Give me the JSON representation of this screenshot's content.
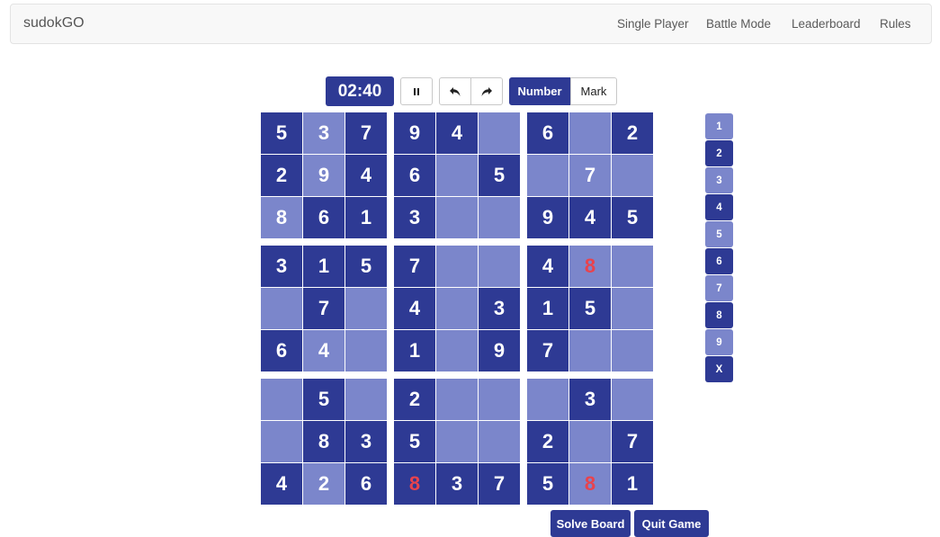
{
  "nav": {
    "brand": "sudokGO",
    "links": [
      "Single Player",
      "Battle Mode",
      "Leaderboard",
      "Rules"
    ]
  },
  "controls": {
    "timer": "02:40",
    "pause_icon": "pause-icon",
    "undo_icon": "undo-arrow-icon",
    "redo_icon": "redo-arrow-icon",
    "mode_number": "Number",
    "mode_mark": "Mark",
    "active_mode": "Number"
  },
  "colors": {
    "given": "#2e3a94",
    "open": "#7b86cb",
    "error_text": "#e8434d"
  },
  "board": [
    [
      "5g",
      "3o",
      "7g",
      "9g",
      "4g",
      "o",
      "6g",
      "o",
      "2g"
    ],
    [
      "2g",
      "9o",
      "4g",
      "6g",
      "o",
      "5g",
      "o",
      "7o",
      "o"
    ],
    [
      "8o",
      "6g",
      "1g",
      "3g",
      "o",
      "o",
      "9g",
      "4g",
      "5g"
    ],
    [
      "3g",
      "1g",
      "5g",
      "7g",
      "o",
      "o",
      "4g",
      "8oe",
      "o"
    ],
    [
      "o",
      "7g",
      "o",
      "4g",
      "o",
      "3g",
      "1g",
      "5g",
      "o"
    ],
    [
      "6g",
      "4o",
      "o",
      "1g",
      "o",
      "9g",
      "7g",
      "o",
      "o"
    ],
    [
      "o",
      "5g",
      "o",
      "2g",
      "o",
      "o",
      "o",
      "3g",
      "o"
    ],
    [
      "o",
      "8g",
      "3g",
      "5g",
      "o",
      "o",
      "2g",
      "o",
      "7g"
    ],
    [
      "4g",
      "2o",
      "6g",
      "8ge",
      "3g",
      "7g",
      "5g",
      "8oe",
      "1g"
    ]
  ],
  "number_pad": [
    {
      "label": "1",
      "style": "light"
    },
    {
      "label": "2",
      "style": "dark"
    },
    {
      "label": "3",
      "style": "light"
    },
    {
      "label": "4",
      "style": "dark"
    },
    {
      "label": "5",
      "style": "light"
    },
    {
      "label": "6",
      "style": "dark"
    },
    {
      "label": "7",
      "style": "light"
    },
    {
      "label": "8",
      "style": "dark"
    },
    {
      "label": "9",
      "style": "light"
    },
    {
      "label": "X",
      "style": "dark"
    }
  ],
  "actions": {
    "solve": "Solve Board",
    "quit": "Quit Game"
  }
}
